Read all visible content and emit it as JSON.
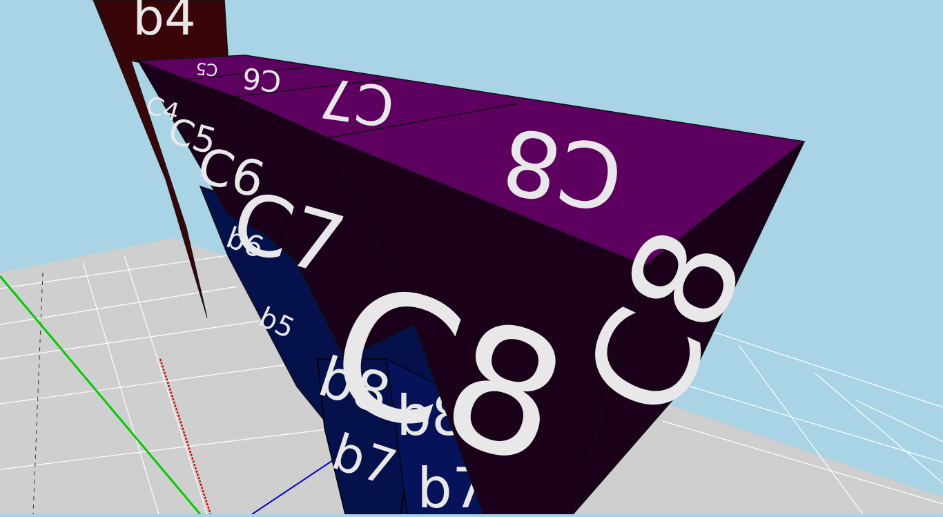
{
  "scene": {
    "colors": {
      "sky": "#a8d4e6",
      "floor": "#cfcfcf",
      "grid_line": "#ffffff",
      "grid_dash": "#333333",
      "purple_top": "#5e0060",
      "purple_dark": "#1a0018",
      "navy": "#04114a",
      "maroon": "#3a0508",
      "label": "#e8e8e8",
      "axis_x": "#dd0000",
      "axis_y": "#00cc00",
      "axis_z": "#0000cc"
    },
    "cube_labels": {
      "c8_top": "C8",
      "c8_front": "C8",
      "c8_side": "C8",
      "c7_top": "C7",
      "c7_front": "C7",
      "c6_front": "C6",
      "c5_front": "C5",
      "c4_front": "C4",
      "c6_top": "C6",
      "c5_top": "C5",
      "b8_front": "b8",
      "b7_front": "b7",
      "b8_side": "b8",
      "b7_side": "b7",
      "b6_front": "b6",
      "b5_front": "b5",
      "b4_back": "b4"
    }
  }
}
